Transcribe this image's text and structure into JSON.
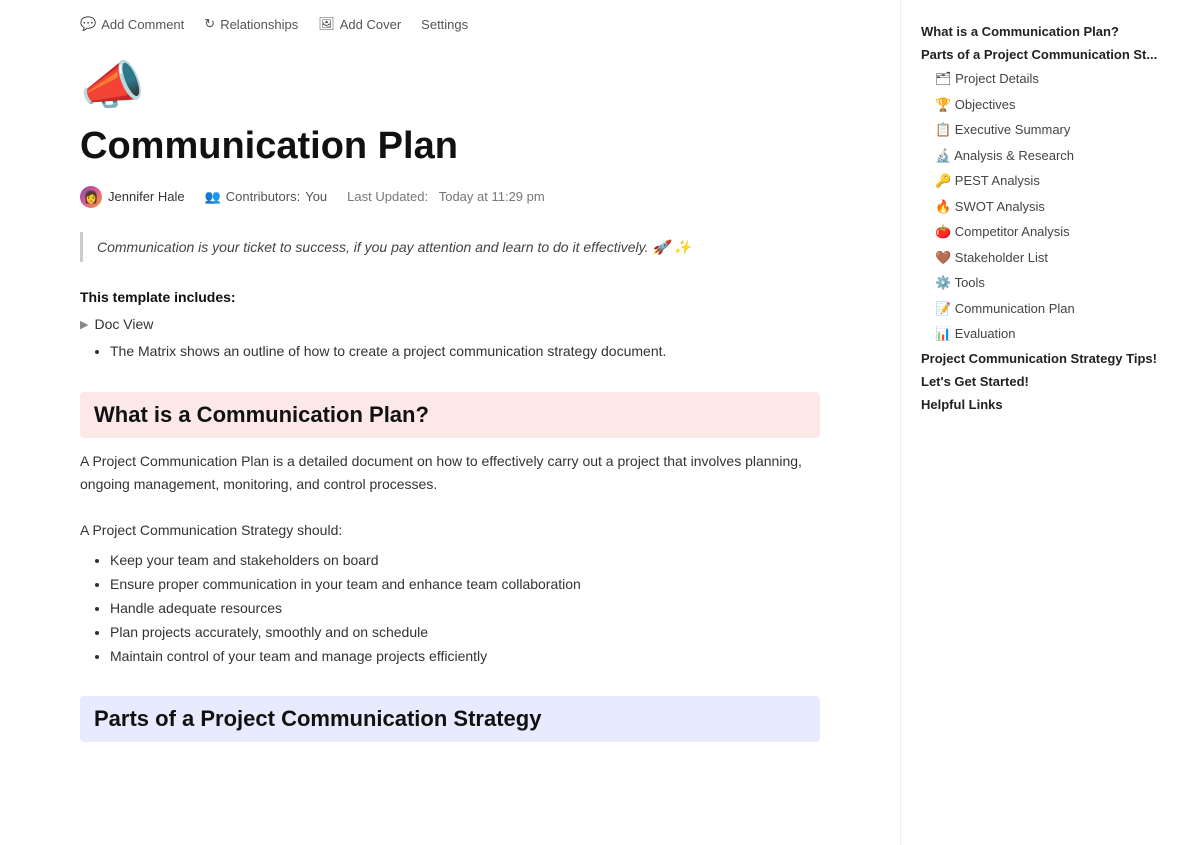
{
  "toolbar": {
    "add_comment": "Add Comment",
    "relationships": "Relationships",
    "add_cover": "Add Cover",
    "settings": "Settings"
  },
  "page": {
    "emoji": "📣",
    "title": "Communication Plan",
    "author": "Jennifer Hale",
    "contributors_label": "Contributors:",
    "contributors_value": "You",
    "last_updated_label": "Last Updated:",
    "last_updated_value": "Today at 11:29 pm"
  },
  "callout": {
    "text": "Communication is your ticket to success, if you pay attention and learn to do it effectively. 🚀 ✨"
  },
  "template_section": {
    "heading": "This template includes:",
    "toggle_label": "Doc View",
    "bullet": "The Matrix shows an outline of how to create a project communication strategy document."
  },
  "section1": {
    "heading": "What is a Communication Plan?",
    "para1": "A Project Communication Plan is a detailed document on how to effectively carry out a project that involves planning, ongoing management, monitoring, and control processes.",
    "para2": "A Project Communication Strategy should:",
    "bullets": [
      "Keep your team and stakeholders on board",
      "Ensure proper communication in your team and enhance team collaboration",
      "Handle adequate resources",
      "Plan projects accurately, smoothly and on schedule",
      "Maintain control of your team and manage projects efficiently"
    ]
  },
  "section2": {
    "heading": "Parts of a Project Communication Strategy"
  },
  "toc": {
    "items": [
      {
        "label": "What is a Communication Plan?",
        "level": "main",
        "indent": false
      },
      {
        "label": "Parts of a Project Communication St...",
        "level": "main",
        "indent": false
      },
      {
        "label": "🗂 Project Details",
        "level": "sub",
        "indent": true
      },
      {
        "label": "🏆 Objectives",
        "level": "sub",
        "indent": true
      },
      {
        "label": "📋 Executive Summary",
        "level": "sub",
        "indent": true
      },
      {
        "label": "🔬 Analysis & Research",
        "level": "sub",
        "indent": true
      },
      {
        "label": "🔑 PEST Analysis",
        "level": "sub",
        "indent": true
      },
      {
        "label": "🔥 SWOT Analysis",
        "level": "sub",
        "indent": true
      },
      {
        "label": "🍅 Competitor Analysis",
        "level": "sub",
        "indent": true
      },
      {
        "label": "🤎 Stakeholder List",
        "level": "sub",
        "indent": true
      },
      {
        "label": "⚙️ Tools",
        "level": "sub",
        "indent": true
      },
      {
        "label": "📝 Communication Plan",
        "level": "sub",
        "indent": true
      },
      {
        "label": "📊 Evaluation",
        "level": "sub",
        "indent": true
      },
      {
        "label": "Project Communication Strategy Tips!",
        "level": "main",
        "indent": false
      },
      {
        "label": "Let's Get Started!",
        "level": "main",
        "indent": false
      },
      {
        "label": "Helpful Links",
        "level": "main",
        "indent": false
      }
    ]
  }
}
